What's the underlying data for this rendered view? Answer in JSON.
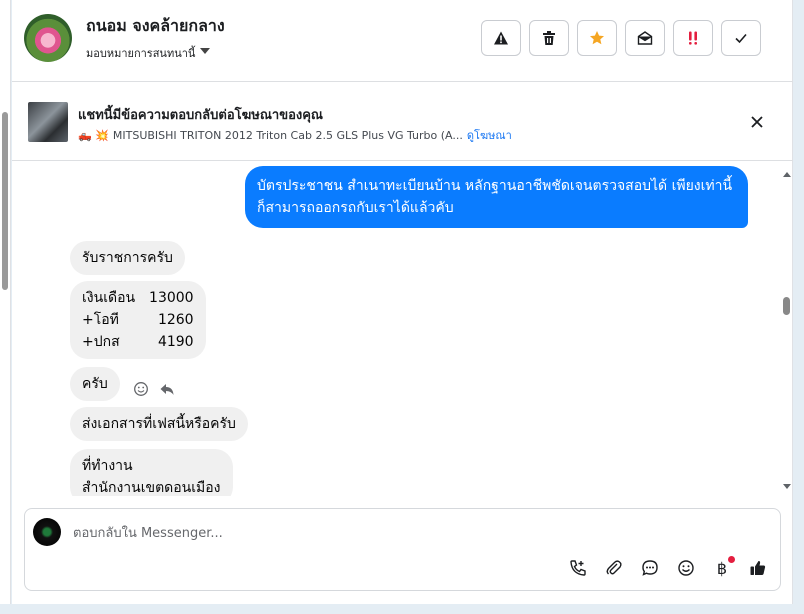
{
  "header": {
    "contact_name": "ถนอม จงคล้ายกลาง",
    "assign_label": "มอบหมายการสนทนานี้",
    "actions": [
      {
        "name": "spam-button",
        "icon": "warning-icon"
      },
      {
        "name": "delete-button",
        "icon": "trash-icon"
      },
      {
        "name": "star-button",
        "icon": "star-icon"
      },
      {
        "name": "mark-unread-button",
        "icon": "envelope-open-icon"
      },
      {
        "name": "priority-button",
        "icon": "double-exclamation-icon"
      },
      {
        "name": "done-button",
        "icon": "check-icon"
      }
    ]
  },
  "ad": {
    "title": "แชทนี้มีข้อความตอบกลับต่อโฆษณาของคุณ",
    "emoji": "🛻 💥",
    "product": "MITSUBISHI TRITON 2012 Triton Cab 2.5 GLS Plus VG Turbo (A...",
    "link": "ดูโฆษณา"
  },
  "messages": {
    "outgoing_1": "บัตรประชาชน สำเนาทะเบียนบ้าน หลักฐานอาชีพชัดเจนตรวจสอบได้ เพียงเท่านี้ก็สามารถออกรถกับเราได้แล้วคับ",
    "incoming_1": "รับราชการครับ",
    "salary": [
      {
        "label": "เงินเดือน",
        "value": "13000"
      },
      {
        "label": "+โอที",
        "value": "1260"
      },
      {
        "label": "+ปกส",
        "value": "4190"
      }
    ],
    "incoming_3": "ครับ",
    "incoming_4": "ส่งเอกสารที่เฟสนี้หรือครับ",
    "incoming_5_line1": "ที่ทำงาน",
    "incoming_5_line2": "สำนักงานเขตดอนเมือง"
  },
  "composer": {
    "placeholder": "ตอบกลับใน Messenger...",
    "baht_symbol": "฿"
  },
  "colors": {
    "outgoing_bubble": "#0a7cff",
    "incoming_bubble": "#f0f0f0",
    "link": "#1876f2",
    "star": "#f5a623",
    "priority": "#e41e3f"
  }
}
